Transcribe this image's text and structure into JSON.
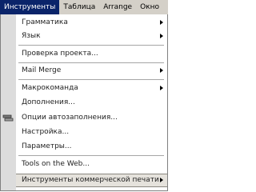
{
  "menubar": {
    "items": [
      {
        "label": "Инструменты"
      },
      {
        "label": "Таблица"
      },
      {
        "label": "Arrange"
      },
      {
        "label": "Окно"
      }
    ]
  },
  "menu": {
    "items": [
      {
        "label": "Грамматика",
        "submenu": true
      },
      {
        "label": "Язык",
        "submenu": true
      },
      {
        "label": "Проверка проекта..."
      },
      {
        "label": "Mail Merge",
        "submenu": true
      },
      {
        "label": "Макрокоманда",
        "submenu": true
      },
      {
        "label": "Дополнения..."
      },
      {
        "label": "Опции автозаполнения..."
      },
      {
        "label": "Настройка..."
      },
      {
        "label": "Параметры..."
      },
      {
        "label": "Tools on the Web..."
      },
      {
        "label": "Инструменты коммерческой печати",
        "submenu": true
      }
    ]
  },
  "icons": {
    "autocorrect": "tools-icon",
    "submenu": "chevron-right-icon"
  },
  "colors": {
    "menubar_bg": "#d4d0c8",
    "active_bg": "#0a246a",
    "icon_strip": "#dcdcdc",
    "highlight_bg": "#e5e2dc"
  }
}
